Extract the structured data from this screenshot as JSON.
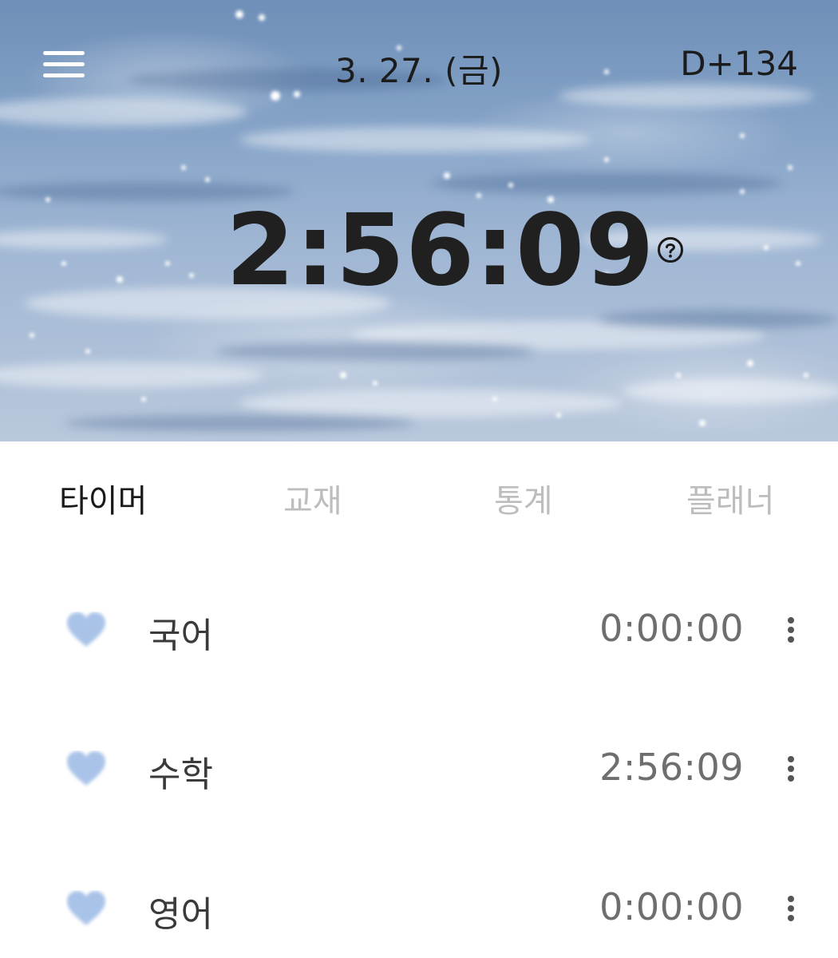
{
  "header": {
    "menu_icon": "hamburger-menu-icon",
    "date": "3. 27. (금)",
    "dday": "D+134",
    "total_time": "2:56:09",
    "help_icon": "question-circle-icon"
  },
  "tabs": [
    {
      "label": "타이머",
      "active": true
    },
    {
      "label": "교재",
      "active": false
    },
    {
      "label": "통계",
      "active": false
    },
    {
      "label": "플래너",
      "active": false
    }
  ],
  "subjects": [
    {
      "name": "국어",
      "time": "0:00:00",
      "icon": "heart-icon",
      "color": "#a9c3e8"
    },
    {
      "name": "수학",
      "time": "2:56:09",
      "icon": "heart-icon",
      "color": "#a9c3e8"
    },
    {
      "name": "영어",
      "time": "0:00:00",
      "icon": "heart-icon",
      "color": "#a9c3e8"
    }
  ],
  "colors": {
    "heart": "#a9c3e8",
    "tab_active": "#1a1a1a",
    "tab_inactive": "#bdbdbd",
    "subject_time": "#6e6e6e"
  }
}
